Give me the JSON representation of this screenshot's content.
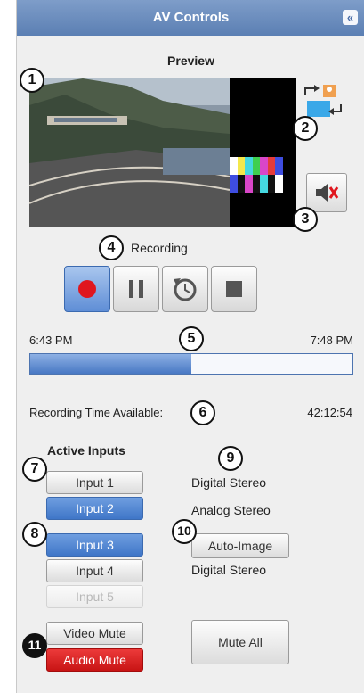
{
  "header": {
    "title": "AV Controls",
    "collapse_glyph": "«"
  },
  "preview": {
    "label": "Preview"
  },
  "recording": {
    "status": "Recording",
    "time_start": "6:43 PM",
    "time_end": "7:48 PM",
    "progress_fraction": 0.5,
    "time_available_label": "Recording Time Available:",
    "time_available_value": "42:12:54"
  },
  "inputs": {
    "heading": "Active Inputs",
    "items": [
      {
        "label": "Input 1",
        "state": "normal"
      },
      {
        "label": "Input 2",
        "state": "selected"
      },
      {
        "label": "Input 3",
        "state": "selected"
      },
      {
        "label": "Input 4",
        "state": "normal"
      },
      {
        "label": "Input 5",
        "state": "disabled"
      }
    ],
    "audio_labels": [
      "Digital Stereo",
      "Analog Stereo",
      "Digital Stereo"
    ],
    "auto_image_label": "Auto-Image"
  },
  "mutes": {
    "video": "Video Mute",
    "audio": "Audio Mute",
    "all": "Mute All"
  },
  "callouts": [
    "1",
    "2",
    "3",
    "4",
    "5",
    "6",
    "7",
    "8",
    "9",
    "10",
    "11"
  ],
  "colors": {
    "accent": "#3f76c8",
    "titlebar": "#5b7fb3",
    "record": "#e0161e",
    "audio_mute": "#c81414"
  }
}
